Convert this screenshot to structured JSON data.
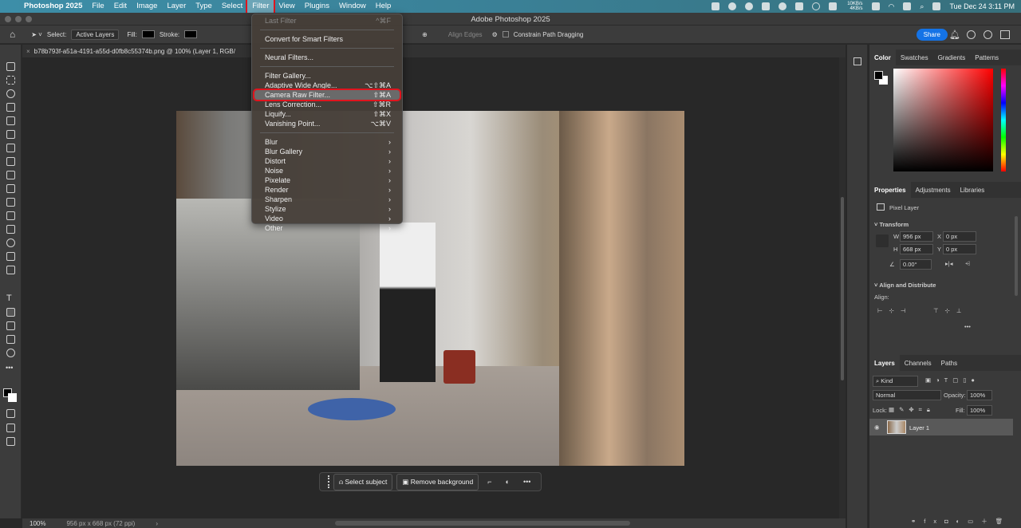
{
  "menubar": {
    "app": "Photoshop 2025",
    "items": [
      "File",
      "Edit",
      "Image",
      "Layer",
      "Type",
      "Select",
      "Filter",
      "View",
      "Plugins",
      "Window",
      "Help"
    ],
    "network": "10KB/s 4KB/s",
    "datetime": "Tue Dec 24  3:11 PM"
  },
  "window": {
    "title": "Adobe Photoshop 2025"
  },
  "options": {
    "select_label": "Select:",
    "select_value": "Active Layers",
    "fill_label": "Fill:",
    "stroke_label": "Stroke:",
    "align_edges": "Align Edges",
    "constrain": "Constrain Path Dragging",
    "share": "Share"
  },
  "document": {
    "tab": "b78b793f-a51a-4191-a55d-d0fb8c55374b.png @ 100% (Layer 1, RGB/",
    "zoom": "100%",
    "info": "956 px x 668 px (72 ppi)"
  },
  "context_bar": {
    "select_subject": "Select subject",
    "remove_background": "Remove background"
  },
  "filter_menu": {
    "groups": [
      [
        {
          "label": "Last Filter",
          "shortcut": "^⌘F",
          "disabled": true
        }
      ],
      [
        {
          "label": "Convert for Smart Filters",
          "shortcut": ""
        }
      ],
      [
        {
          "label": "Neural Filters...",
          "shortcut": ""
        }
      ],
      [
        {
          "label": "Filter Gallery...",
          "shortcut": ""
        },
        {
          "label": "Adaptive Wide Angle...",
          "shortcut": "⌥⇧⌘A"
        },
        {
          "label": "Camera Raw Filter...",
          "shortcut": "⇧⌘A",
          "highlighted": true
        },
        {
          "label": "Lens Correction...",
          "shortcut": "⇧⌘R"
        },
        {
          "label": "Liquify...",
          "shortcut": "⇧⌘X"
        },
        {
          "label": "Vanishing Point...",
          "shortcut": "⌥⌘V"
        }
      ],
      [
        {
          "label": "Blur",
          "shortcut": "›"
        },
        {
          "label": "Blur Gallery",
          "shortcut": "›"
        },
        {
          "label": "Distort",
          "shortcut": "›"
        },
        {
          "label": "Noise",
          "shortcut": "›"
        },
        {
          "label": "Pixelate",
          "shortcut": "›"
        },
        {
          "label": "Render",
          "shortcut": "›"
        },
        {
          "label": "Sharpen",
          "shortcut": "›"
        },
        {
          "label": "Stylize",
          "shortcut": "›"
        },
        {
          "label": "Video",
          "shortcut": "›"
        },
        {
          "label": "Other",
          "shortcut": "›"
        }
      ]
    ]
  },
  "color_panel": {
    "tabs": [
      "Color",
      "Swatches",
      "Gradients",
      "Patterns"
    ],
    "hue_color": "#ff0000"
  },
  "properties": {
    "tabs": [
      "Properties",
      "Adjustments",
      "Libraries"
    ],
    "kind": "Pixel Layer",
    "transform": "Transform",
    "w": "956 px",
    "h": "668 px",
    "x": "0 px",
    "y": "0 px",
    "angle": "0.00°",
    "align_section": "Align and Distribute",
    "align_label": "Align:"
  },
  "layers": {
    "tabs": [
      "Layers",
      "Channels",
      "Paths"
    ],
    "filter": "Kind",
    "blend": "Normal",
    "opacity_label": "Opacity:",
    "opacity": "100%",
    "lock_label": "Lock:",
    "fill_label": "Fill:",
    "fill": "100%",
    "items": [
      {
        "name": "Layer 1"
      }
    ]
  }
}
